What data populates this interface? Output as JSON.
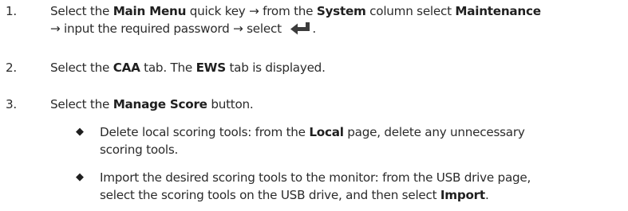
{
  "steps": [
    {
      "number": "1.",
      "t1": "Select the ",
      "b1": "Main Menu",
      "t2": " quick key → from the ",
      "b2": "System",
      "t3": " column select ",
      "b3": "Maintenance",
      "t4": "→ input the required password → select ",
      "t5": ".",
      "icon": "enter-key-icon"
    },
    {
      "number": "2.",
      "t1": "Select the ",
      "b1": "CAA",
      "t2": " tab. The ",
      "b2": "EWS",
      "t3": " tab is displayed."
    },
    {
      "number": "3.",
      "t1": "Select the ",
      "b1": "Manage Score",
      "t2": " button."
    }
  ],
  "bullets": [
    {
      "symbol": "◆",
      "line1_a": "Delete local scoring tools: from the ",
      "line1_b": "Local",
      "line1_c": " page, delete any unnecessary",
      "line2": "scoring tools."
    },
    {
      "symbol": "◆",
      "line1": "Import the desired scoring tools to the monitor: from the USB drive page,",
      "line2_a": "select the scoring tools on the USB drive, and then select ",
      "line2_b": "Import",
      "line2_c": "."
    }
  ]
}
